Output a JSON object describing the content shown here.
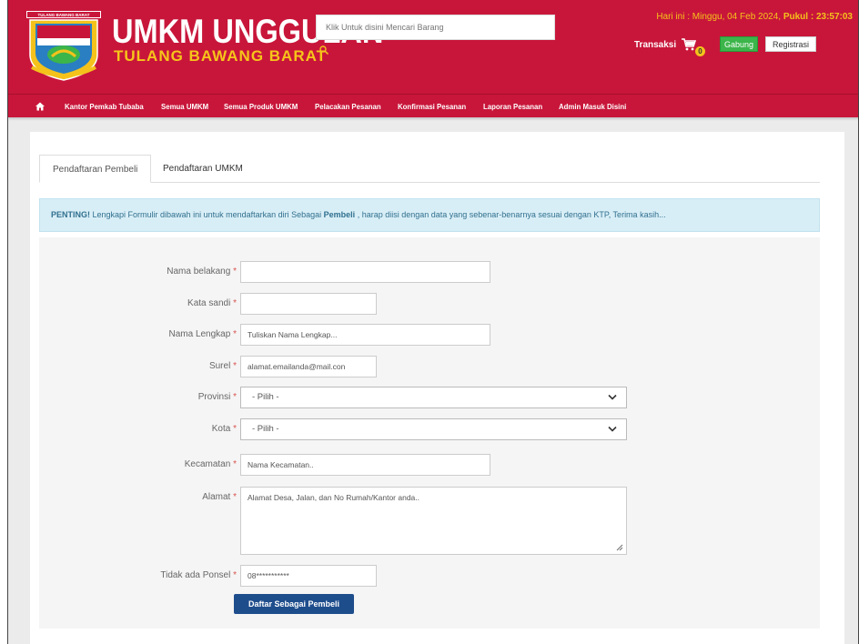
{
  "header": {
    "logo_text": "TULANG BAWANG BARAT",
    "brand_title": "UMKM UNGGULAN",
    "brand_subtitle": "TULANG BAWANG BARAT",
    "search_placeholder": "Klik Untuk disini Mencari Barang",
    "date_prefix": "Hari ini : Minggu, 04 Feb 2024,",
    "time_label": "Pukul : 23:57:03",
    "transaksi_label": "Transaksi",
    "cart_count": "0",
    "gabung_label": "Gabung",
    "registrasi_label": "Registrasi"
  },
  "nav": {
    "items": [
      "Kantor Pemkab Tubaba",
      "Semua UMKM",
      "Semua Produk UMKM",
      "Pelacakan Pesanan",
      "Konfirmasi Pesanan",
      "Laporan Pesanan",
      "Admin Masuk Disini"
    ]
  },
  "tabs": {
    "buyer": "Pendaftaran Pembeli",
    "umkm": "Pendaftaran UMKM"
  },
  "alert": {
    "strong": "PENTING!",
    "text_before": " Lengkapi Formulir dibawah ini untuk mendaftarkan diri Sebagai ",
    "strong2": "Pembeli",
    "text_after": " , harap diisi dengan data yang sebenar-benarnya sesuai dengan KTP, Terima kasih..."
  },
  "form": {
    "nama_belakang_label": "Nama belakang",
    "kata_sandi_label": "Kata sandi",
    "nama_lengkap_label": "Nama Lengkap",
    "nama_lengkap_placeholder": "Tuliskan Nama Lengkap...",
    "surel_label": "Surel",
    "surel_placeholder": "alamat.emailanda@mail.con",
    "provinsi_label": "Provinsi",
    "provinsi_value": "- Pilih -",
    "kota_label": "Kota",
    "kota_value": "- Pilih -",
    "kecamatan_label": "Kecamatan",
    "kecamatan_placeholder": "Nama Kecamatan..",
    "alamat_label": "Alamat",
    "alamat_placeholder": "Alamat Desa, Jalan, dan No Rumah/Kantor anda..",
    "ponsel_label": "Tidak ada Ponsel",
    "ponsel_placeholder": "08***********",
    "required_mark": "*",
    "submit_label": "Daftar Sebagai Pembeli"
  },
  "colors": {
    "header_red": "#c8163a",
    "accent_yellow": "#f4c21b",
    "gabung_green": "#3cb54a",
    "submit_blue": "#1e4d8c",
    "alert_bg": "#d8eef6"
  }
}
